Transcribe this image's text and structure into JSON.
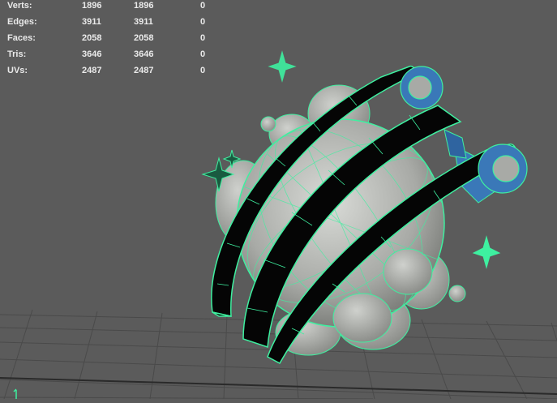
{
  "hud": {
    "rows": [
      {
        "label": "Verts:",
        "v1": "1896",
        "v2": "1896",
        "v3": "0"
      },
      {
        "label": "Edges:",
        "v1": "3911",
        "v2": "3911",
        "v3": "0"
      },
      {
        "label": "Faces:",
        "v1": "2058",
        "v2": "2058",
        "v3": "0"
      },
      {
        "label": "Tris:",
        "v1": "3646",
        "v2": "3646",
        "v3": "0"
      },
      {
        "label": "UVs:",
        "v1": "2487",
        "v2": "2487",
        "v3": "0"
      }
    ]
  },
  "colors": {
    "background": "#5b5b5b",
    "grid": "#4a4a4a",
    "wireframe": "#3ef0a0",
    "shaded": "#a8aaa6",
    "rings": "#050505",
    "secondary_mesh": "#3a78b8",
    "hud_text": "#eaeaea"
  },
  "icons": {
    "model": "sparkle-sphere-model-icon",
    "axis": "axis-gizmo-icon"
  }
}
